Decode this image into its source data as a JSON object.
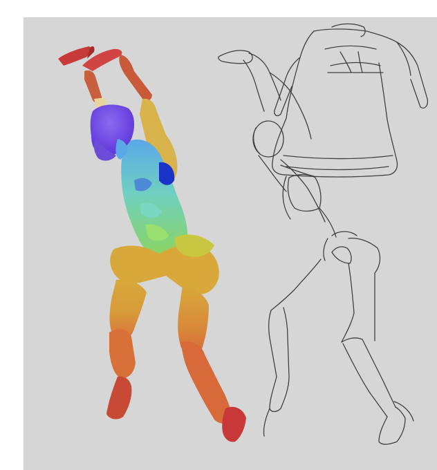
{
  "artwork": {
    "background_color": "#d6d6d6",
    "margin_color": "#ffffff",
    "painted_figure_colors": {
      "head": "#6a3ee0",
      "hands": "#c83a3a",
      "forearms": "#c85a3a",
      "upper_arms": "#d8b24a",
      "torso": "#6fd0c0",
      "abdomen": "#8ed45a",
      "hips_thighs": "#d8a83a",
      "shins": "#d8703a",
      "feet": "#c83838"
    },
    "sketch_line_color": "#3f3f3f"
  }
}
